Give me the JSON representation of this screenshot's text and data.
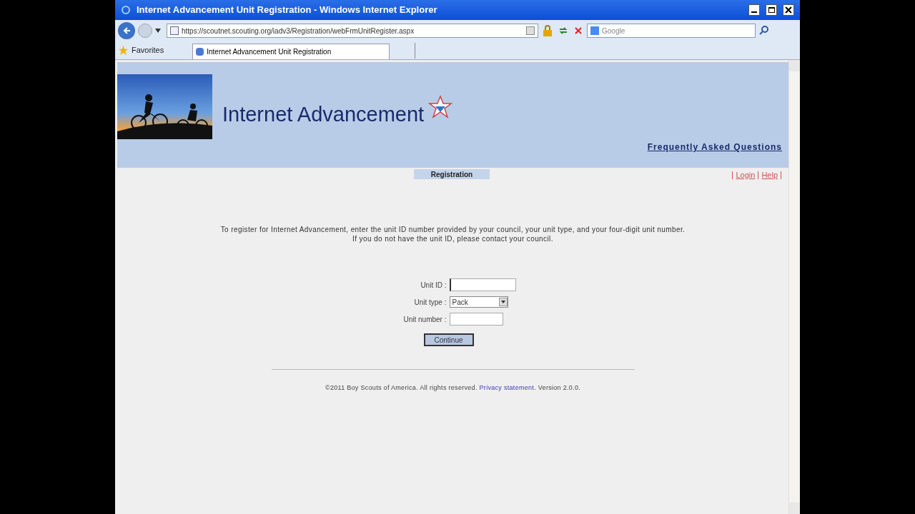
{
  "window": {
    "title": "Internet Advancement Unit Registration - Windows Internet Explorer"
  },
  "address_bar": {
    "value": "https://scoutnet.scouting.org/iadv3/Registration/webFrmUnitRegister.aspx"
  },
  "search": {
    "placeholder": "Google"
  },
  "favorites_bar": {
    "label": "Favorites",
    "tabs": [
      {
        "label": "Internet Advancement Unit Registration",
        "selected": true
      }
    ]
  },
  "header": {
    "title": "Internet Advancement",
    "faq_link": "Frequently Asked Questions"
  },
  "nav": {
    "current": "Registration",
    "links": [
      "Login",
      "Help"
    ]
  },
  "intro": [
    "To register for Internet Advancement, enter the unit ID number provided by your council, your unit type, and your four-digit unit number.",
    "If you do not have the unit ID, please contact your council."
  ],
  "form": {
    "fields": [
      {
        "kind": "text",
        "label": "Unit ID :",
        "focused": true
      },
      {
        "kind": "select",
        "label": "Unit type :",
        "value": "Pack"
      },
      {
        "kind": "text",
        "label": "Unit number :",
        "focused": false
      }
    ],
    "submit": "Continue"
  },
  "footer": {
    "copyright": "©2011 Boy Scouts of America. All rights reserved.",
    "privacy_link": "Privacy statement.",
    "version": "Version 2.0.0."
  }
}
